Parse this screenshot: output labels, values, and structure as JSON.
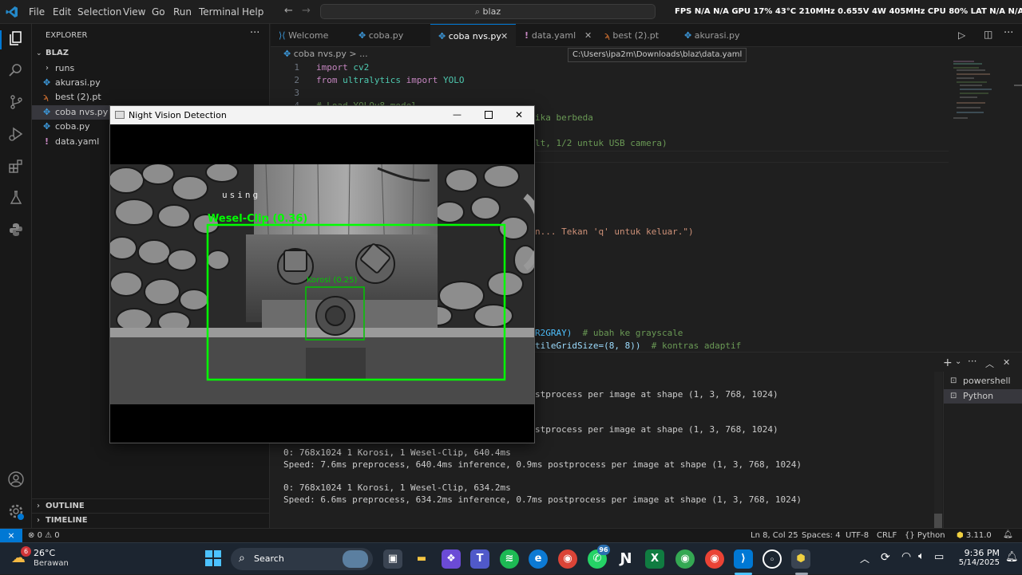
{
  "menu": [
    "File",
    "Edit",
    "Selection",
    "View",
    "Go",
    "Run",
    "Terminal",
    "Help"
  ],
  "search": {
    "text": "blaz"
  },
  "perf_overlay": "FPS N/A N/A   GPU 17% 43°C 210MHz 0.655V 4W 405MHz   CPU 80%   LAT N/A N/A",
  "sidebar": {
    "title": "EXPLORER",
    "folder": "BLAZ",
    "items": [
      {
        "label": "runs",
        "type": "folder"
      },
      {
        "label": "akurasi.py",
        "type": "py"
      },
      {
        "label": "best (2).pt",
        "type": "pt"
      },
      {
        "label": "coba nvs.py",
        "type": "py",
        "selected": true
      },
      {
        "label": "coba.py",
        "type": "py"
      },
      {
        "label": "data.yaml",
        "type": "yaml"
      }
    ],
    "outline": "OUTLINE",
    "timeline": "TIMELINE"
  },
  "tabs": [
    {
      "label": "Welcome"
    },
    {
      "label": "coba.py"
    },
    {
      "label": "coba nvs.py",
      "active": true
    },
    {
      "label": "data.yaml"
    },
    {
      "label": "best (2).pt"
    },
    {
      "label": "akurasi.py"
    }
  ],
  "breadcrumb": "coba nvs.py > ...",
  "tooltip": "C:\\Users\\ipa2m\\Downloads\\blaz\\data.yaml",
  "code": {
    "line1_kw": "import",
    "line1_mod": "cv2",
    "line2_kw": "from",
    "line2_mod": "ultralytics",
    "line2_kw2": "import",
    "line2_cls": "YOLO",
    "line4": "# Load YOLOv8 model",
    "frag_a": "ika berbeda",
    "frag_b": "lt, 1/2 untuk USB camera)",
    "frag_c": "n... Tekan 'q' untuk keluar.\")",
    "frag_d1": "R2GRAY)",
    "frag_d2": "  # ubah ke grayscale",
    "frag_e1": "tileGridSize=(8, 8))",
    "frag_e2": "  # kontras adaptif"
  },
  "terminal": {
    "lines": [
      "stprocess per image at shape (1, 3, 768, 1024)",
      "stprocess per image at shape (1, 3, 768, 1024)",
      "0: 768x1024 1 Korosi, 1 Wesel-Clip, 640.4ms",
      "Speed: 7.6ms preprocess, 640.4ms inference, 0.9ms postprocess per image at shape (1, 3, 768, 1024)",
      "0: 768x1024 1 Korosi, 1 Wesel-Clip, 634.2ms",
      "Speed: 6.6ms preprocess, 634.2ms inference, 0.7ms postprocess per image at shape (1, 3, 768, 1024)"
    ],
    "shells": [
      "powershell",
      "Python"
    ]
  },
  "statusbar": {
    "errors": "0",
    "warnings": "0",
    "position": "Ln 8, Col 25",
    "spaces": "Spaces: 4",
    "encoding": "UTF-8",
    "eol": "CRLF",
    "language": "Python",
    "version": "3.11.0"
  },
  "window": {
    "title": "Night Vision Detection",
    "camera_text": "using",
    "detections": [
      {
        "label": "Wesel-Clip (0.36)",
        "color": "#00ff00"
      },
      {
        "label": "Korosi (0.25)",
        "color": "#00c800"
      }
    ]
  },
  "taskbar": {
    "temp": "26°C",
    "weather": "Berawan",
    "weather_badge": "6",
    "search": "Search",
    "whatsapp_badge": "96",
    "time": "9:36 PM",
    "date": "5/14/2025"
  },
  "colors": {
    "accent": "#0078d4",
    "keyword": "#c586c0",
    "module": "#4ec9b0",
    "comment": "#6a9955",
    "string": "#ce9178",
    "detect": "#00ff00"
  }
}
